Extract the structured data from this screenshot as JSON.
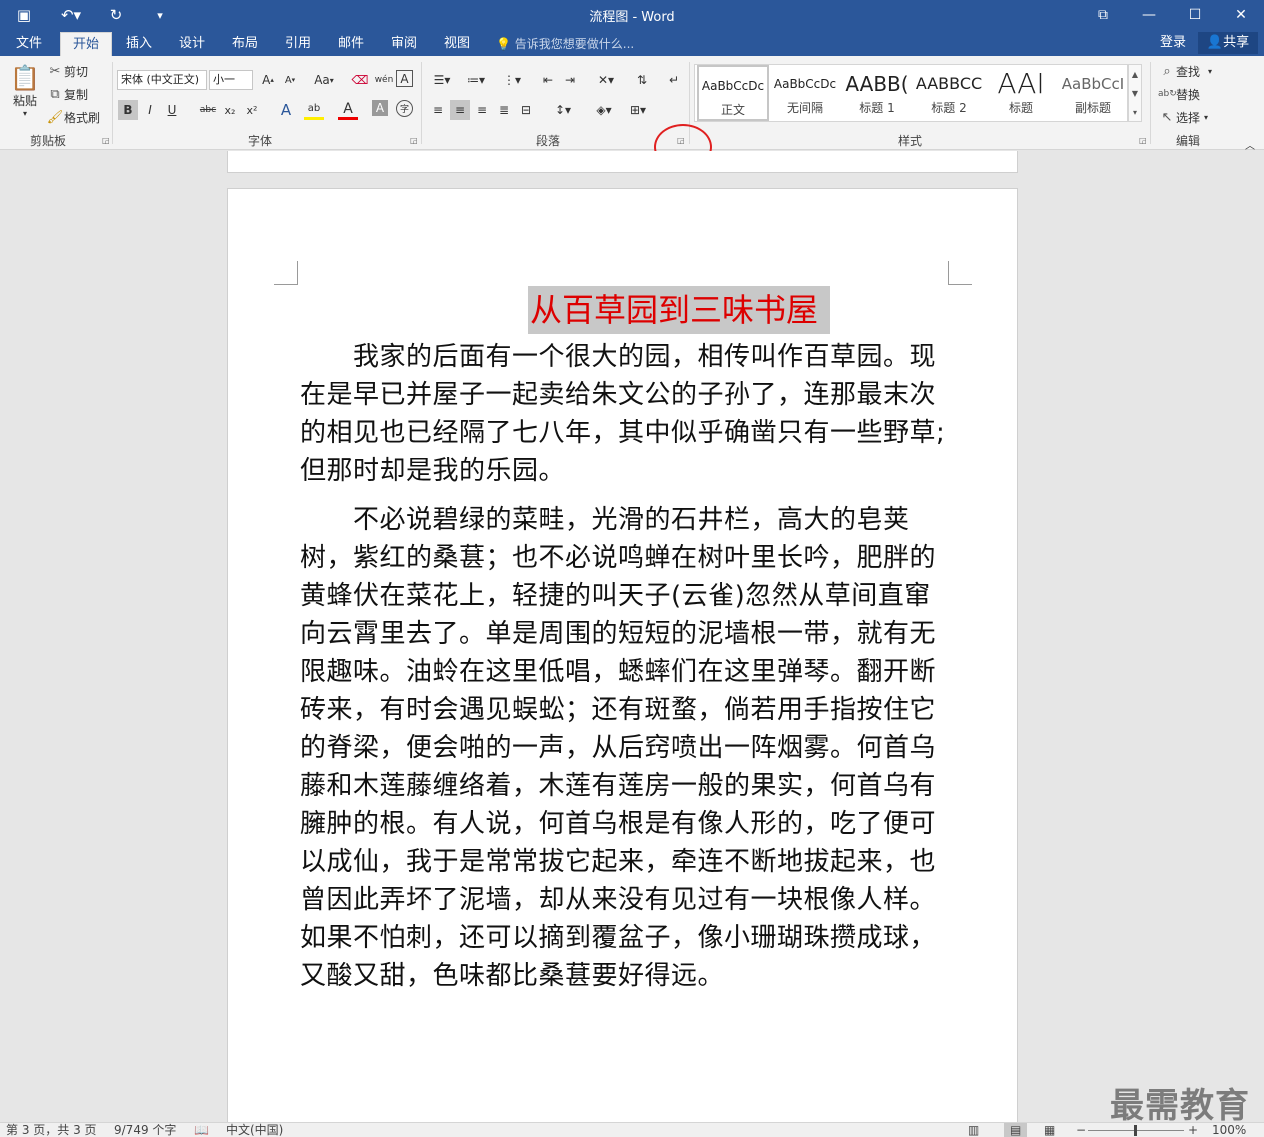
{
  "window": {
    "title": "流程图 - Word",
    "quick_access": {
      "save": "save-icon",
      "undo": "undo-icon",
      "redo": "redo-icon",
      "customize": "customize-icon"
    },
    "controls": {
      "ribbon_display": "ribbon-display-icon",
      "minimize": "minimize-icon",
      "maximize": "maximize-icon",
      "close": "close-icon"
    }
  },
  "tabs": [
    "文件",
    "开始",
    "插入",
    "设计",
    "布局",
    "引用",
    "邮件",
    "审阅",
    "视图"
  ],
  "active_tab": "开始",
  "tell_me": "告诉我您想要做什么...",
  "login": "登录",
  "share": "共享",
  "ribbon": {
    "clipboard": {
      "paste": "粘贴",
      "cut": "剪切",
      "copy": "复制",
      "format_painter": "格式刷",
      "group": "剪贴板"
    },
    "font": {
      "font_name": "宋体 (中文正文)",
      "font_size": "小一",
      "group": "字体",
      "grow": "A",
      "shrink": "A",
      "case": "Aa",
      "bold": "B",
      "italic": "I",
      "underline": "U",
      "strike": "abc",
      "subscript": "x₂",
      "superscript": "x²",
      "effects": "A",
      "highlight": "ab",
      "color": "A",
      "shade": "A",
      "enclose": "字"
    },
    "paragraph": {
      "group": "段落"
    },
    "styles": {
      "group": "样式",
      "items": [
        {
          "preview": "AaBbCcDc",
          "name": "正文"
        },
        {
          "preview": "AaBbCcDc",
          "name": "无间隔"
        },
        {
          "preview": "AABB(",
          "name": "标题 1"
        },
        {
          "preview": "AABBCC",
          "name": "标题 2"
        },
        {
          "preview": "AAI",
          "name": "标题"
        },
        {
          "preview": "AaBbCcI",
          "name": "副标题"
        }
      ]
    },
    "editing": {
      "find": "查找",
      "replace": "替换",
      "select": "选择",
      "group": "编辑"
    }
  },
  "document": {
    "heading": "从百草园到三味书屋",
    "paragraphs": [
      "　　我家的后面有一个很大的园，相传叫作百草园。现在是早已并屋子一起卖给朱文公的子孙了，连那最末次的相见也已经隔了七八年，其中似乎确凿只有一些野草;但那时却是我的乐园。",
      "　　不必说碧绿的菜畦，光滑的石井栏，高大的皂荚树，紫红的桑葚；也不必说鸣蝉在树叶里长吟，肥胖的黄蜂伏在菜花上，轻捷的叫天子(云雀)忽然从草间直窜向云霄里去了。单是周围的短短的泥墙根一带，就有无限趣味。油蛉在这里低唱，蟋蟀们在这里弹琴。翻开断砖来，有时会遇见蜈蚣；还有斑蝥，倘若用手指按住它的脊梁，便会啪的一声，从后窍喷出一阵烟雾。何首乌藤和木莲藤缠络着，木莲有莲房一般的果实，何首乌有臃肿的根。有人说，何首乌根是有像人形的，吃了便可以成仙，我于是常常拔它起来，牵连不断地拔起来，也曾因此弄坏了泥墙，却从来没有见过有一块根像人样。如果不怕刺，还可以摘到覆盆子，像小珊瑚珠攒成球，又酸又甜，色味都比桑葚要好得远。"
    ]
  },
  "status": {
    "page": "第 3 页，共 3 页",
    "words": "9/749 个字",
    "language": "中文(中国)",
    "zoom": "100%"
  },
  "watermark": "最需教育"
}
